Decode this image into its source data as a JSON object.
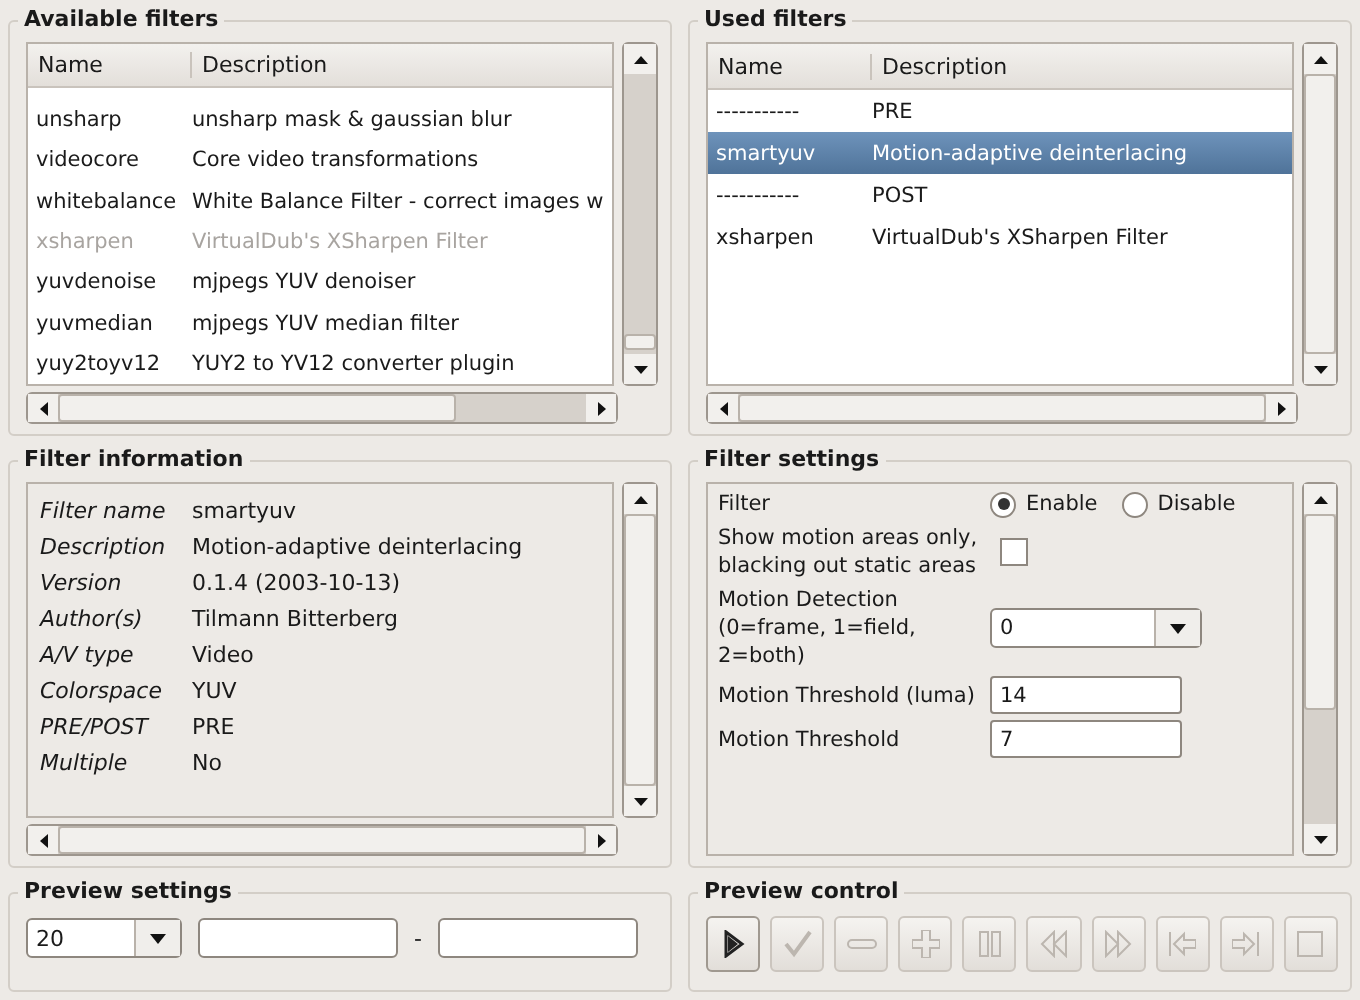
{
  "available_filters": {
    "title": "Available filters",
    "columns": [
      "Name",
      "Description"
    ],
    "rows": [
      {
        "name": "unsharp",
        "description": "unsharp mask & gaussian blur",
        "disabled": false
      },
      {
        "name": "videocore",
        "description": "Core video transformations",
        "disabled": false
      },
      {
        "name": "whitebalance",
        "description": "White Balance Filter - correct images w",
        "disabled": false
      },
      {
        "name": "xsharpen",
        "description": "VirtualDub's XSharpen Filter",
        "disabled": true
      },
      {
        "name": "yuvdenoise",
        "description": "mjpegs YUV denoiser",
        "disabled": false
      },
      {
        "name": "yuvmedian",
        "description": "mjpegs YUV median filter",
        "disabled": false
      },
      {
        "name": "yuy2toyv12",
        "description": "YUY2 to YV12 converter plugin",
        "disabled": false
      }
    ]
  },
  "used_filters": {
    "title": "Used filters",
    "columns": [
      "Name",
      "Description"
    ],
    "rows": [
      {
        "name": "-----------",
        "description": "PRE",
        "selected": false
      },
      {
        "name": "smartyuv",
        "description": "Motion-adaptive deinterlacing",
        "selected": true
      },
      {
        "name": "-----------",
        "description": "POST",
        "selected": false
      },
      {
        "name": "xsharpen",
        "description": "VirtualDub's XSharpen Filter",
        "selected": false
      }
    ]
  },
  "filter_information": {
    "title": "Filter information",
    "rows": [
      {
        "key": "Filter name",
        "value": "smartyuv"
      },
      {
        "key": "Description",
        "value": "Motion-adaptive deinterlacing"
      },
      {
        "key": "Version",
        "value": "0.1.4 (2003-10-13)"
      },
      {
        "key": "Author(s)",
        "value": "Tilmann Bitterberg"
      },
      {
        "key": "A/V type",
        "value": "Video"
      },
      {
        "key": "Colorspace",
        "value": "YUV"
      },
      {
        "key": "PRE/POST",
        "value": "PRE"
      },
      {
        "key": "Multiple",
        "value": "No"
      }
    ]
  },
  "filter_settings": {
    "title": "Filter settings",
    "rows": [
      {
        "kind": "radio",
        "label": "Filter",
        "options": [
          {
            "label": "Enable",
            "selected": true
          },
          {
            "label": "Disable",
            "selected": false
          }
        ]
      },
      {
        "kind": "checkbox",
        "label": "Show motion areas only, blacking out static areas",
        "checked": false
      },
      {
        "kind": "dropdown",
        "label": "Motion Detection (0=frame, 1=field, 2=both)",
        "value": "0"
      },
      {
        "kind": "text",
        "label": "Motion Threshold (luma)",
        "value": "14"
      },
      {
        "kind": "text",
        "label": "Motion Threshold",
        "value": "7"
      }
    ]
  },
  "preview_settings": {
    "title": "Preview settings",
    "dropdown": "20",
    "separator": "-"
  },
  "preview_control": {
    "title": "Preview control",
    "buttons": [
      {
        "disabled": false
      },
      {
        "disabled": true
      },
      {
        "disabled": true
      },
      {
        "disabled": true
      },
      {
        "disabled": true
      },
      {
        "disabled": true
      },
      {
        "disabled": true
      },
      {
        "disabled": true
      },
      {
        "disabled": true
      },
      {
        "disabled": true
      }
    ]
  }
}
